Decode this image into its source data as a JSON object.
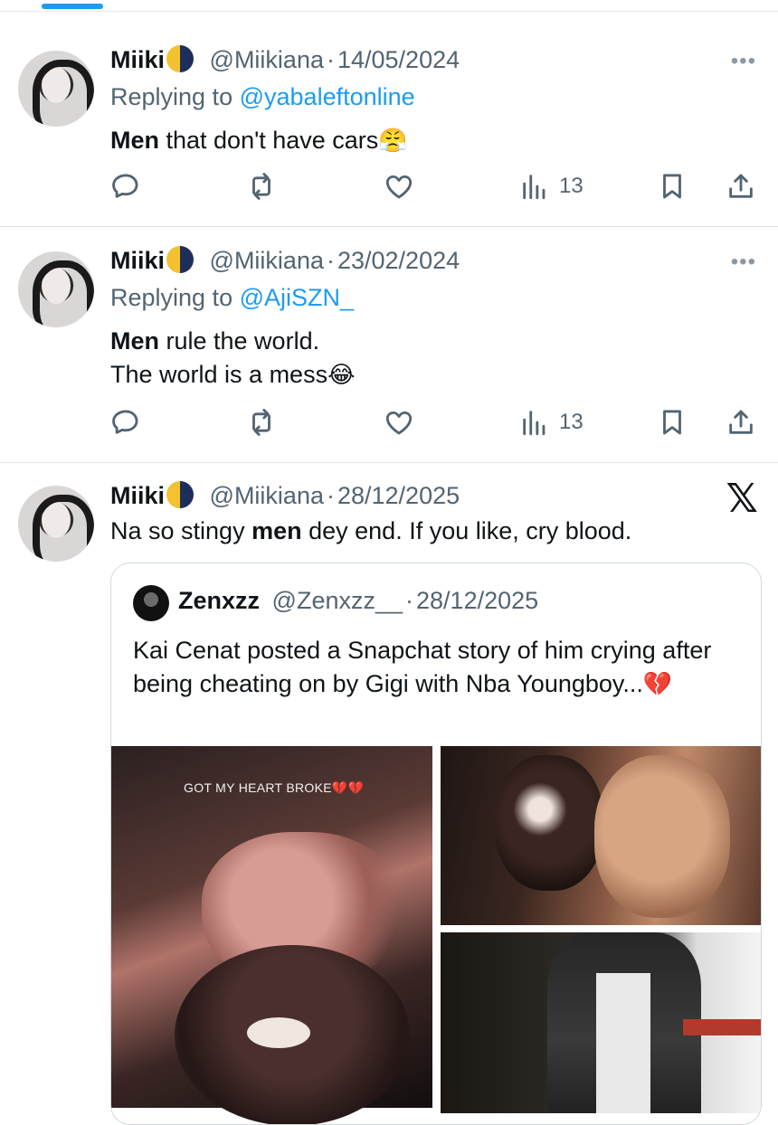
{
  "tweets": [
    {
      "name": "Miiki",
      "handle": "@Miikiana",
      "sep": "·",
      "date": "14/05/2024",
      "reply_prefix": "Replying to",
      "reply_to": "@yabaleftonline",
      "text_bold": "Men",
      "text_rest": " that don't have cars",
      "emoji": "😤",
      "more": "•••",
      "views": "13"
    },
    {
      "name": "Miiki",
      "handle": "@Miikiana",
      "sep": "·",
      "date": "23/02/2024",
      "reply_prefix": "Replying to",
      "reply_to": "@AjiSZN_",
      "text_bold": "Men",
      "text_rest": " rule the world.",
      "text_line2": "The world is a  mess",
      "emoji": "😂",
      "more": "•••",
      "views": "13"
    },
    {
      "name": "Miiki",
      "handle": "@Miikiana",
      "sep": "·",
      "date": "28/12/2025",
      "text_pre": "Na so stingy ",
      "text_bold": "men",
      "text_rest": " dey end. If you like, cry blood.",
      "logo": "𝕏",
      "quote": {
        "name": "Zenxzz",
        "handle": "@Zenxzz__",
        "sep": "·",
        "date": "28/12/2025",
        "text": "Kai Cenat posted a Snapchat story of him crying after being cheating on by Gigi with Nba Youngboy...",
        "emoji": "💔",
        "image_caption": "GOT MY HEART BROKE💔💔"
      }
    }
  ],
  "icons": [
    "reply-icon",
    "retweet-icon",
    "like-icon",
    "views-icon",
    "bookmark-icon",
    "share-icon",
    "more-icon",
    "verified-moon-icon",
    "x-logo-icon"
  ],
  "colors": {
    "accent": "#1d9bf0",
    "muted": "#536471",
    "text": "#0f1419",
    "border": "#cfd9de"
  }
}
